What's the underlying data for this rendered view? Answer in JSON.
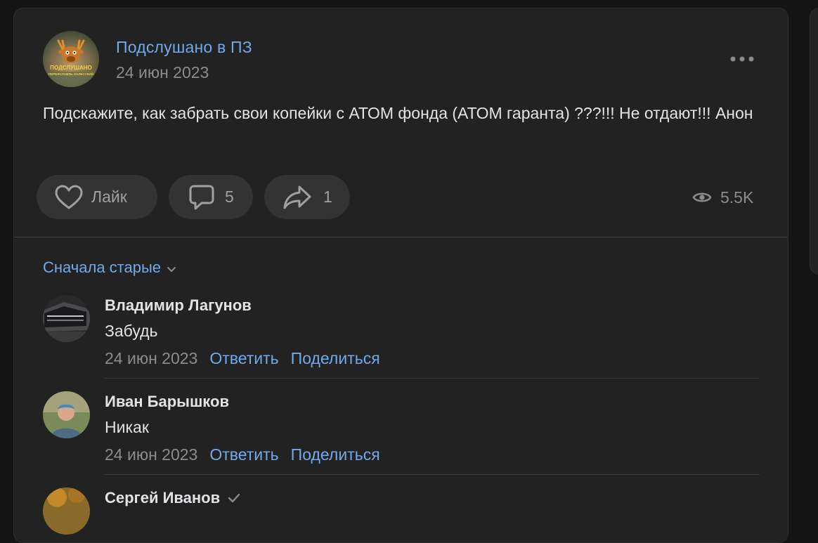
{
  "post": {
    "author": "Подслушано в ПЗ",
    "date": "24 июн 2023",
    "text": "Подскажите, как забрать свои копейки с АТОМ фонда (АТОМ гаранта) ???!!! Не отдают!!! Анон",
    "avatar_text_line1": "ПОДСЛУШАНО",
    "avatar_text_line2": "ПЕРЕЯСЛАВЛЬ-ЗАЛЕССКИЙ",
    "more_icon": "more-horizontal-icon",
    "actions": {
      "like_label": "Лайк",
      "like_icon": "heart-icon",
      "comments_count": "5",
      "comments_icon": "comment-icon",
      "shares_count": "1",
      "share_icon": "share-icon",
      "views": "5.5K",
      "views_icon": "eye-icon"
    }
  },
  "comments_section": {
    "sort_label": "Сначала старые",
    "sort_icon": "chevron-down-icon",
    "comments": [
      {
        "name": "Владимир Лагунов",
        "text": "Забудь",
        "date": "24 июн 2023",
        "reply": "Ответить",
        "share": "Поделиться"
      },
      {
        "name": "Иван Барышков",
        "text": "Никак",
        "date": "24 июн 2023",
        "reply": "Ответить",
        "share": "Поделиться"
      },
      {
        "name": "Сергей Иванов",
        "verified_icon": "check-icon"
      }
    ]
  },
  "colors": {
    "background": "#141414",
    "card": "#222222",
    "accent_link": "#71aaeb",
    "text_primary": "#e1e3e6",
    "text_secondary": "#8c8c8c",
    "pill_bg": "#333333"
  }
}
